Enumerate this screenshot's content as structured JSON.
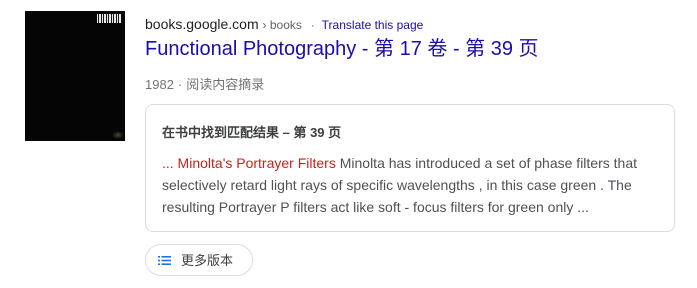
{
  "result": {
    "domain": "books.google.com",
    "breadcrumb": "› books",
    "separator": "·",
    "translate_link": "Translate this page",
    "title": "Functional Photography - 第 17 卷 - 第 39 页",
    "year": "1982",
    "meta_separator": "·",
    "snippet_type": "阅读内容摘录"
  },
  "excerpt": {
    "heading": "在书中找到匹配结果 – 第 39 页",
    "highlight": "... Minolta's Portrayer Filters",
    "text": " Minolta has introduced a set of phase filters that selectively retard light rays of specific wavelengths , in this case green . The resulting Portrayer P filters act like soft - focus filters for green only ..."
  },
  "more_versions": {
    "label": "更多版本",
    "icon": "list-icon"
  },
  "colors": {
    "link": "#1a0dab",
    "highlight": "#c5221f",
    "thumbnail": "#050505"
  }
}
